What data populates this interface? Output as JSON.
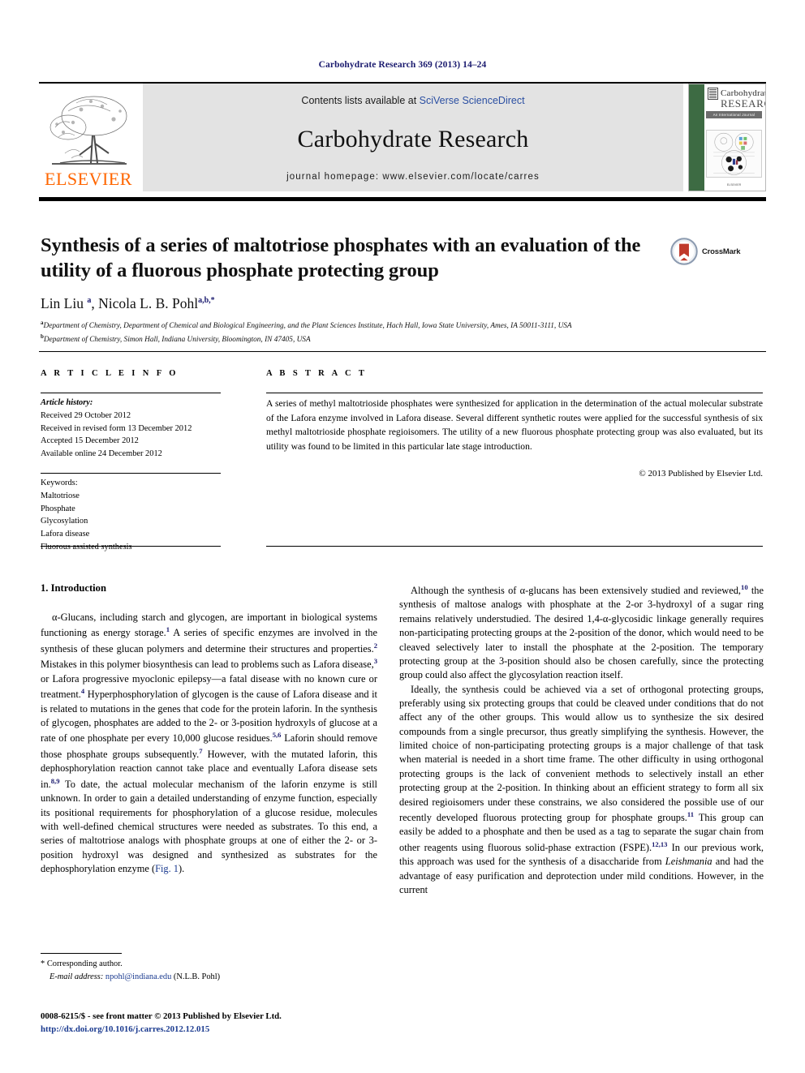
{
  "running_head": "Carbohydrate Research 369 (2013) 14–24",
  "masthead": {
    "publisher_logo_label": "ELSEVIER",
    "contents_prefix": "Contents lists available at ",
    "contents_link": "SciVerse ScienceDirect",
    "journal_title": "Carbohydrate Research",
    "homepage": "journal homepage: www.elsevier.com/locate/carres",
    "cover": {
      "line1": "Carbohydrate",
      "line2": "RESEARCH",
      "strap": "An International Journal",
      "footer": "ELSEVIER"
    }
  },
  "article": {
    "title": "Synthesis of a series of maltotriose phosphates with an evaluation of the utility of a fluorous phosphate protecting group",
    "crossmark_label": "CrossMark",
    "authors_html": "Lin Liu <sup>a</sup>, Nicola L. B. Pohl<sup>a,b,</sup><sup>*</sup>",
    "affiliations": [
      "Department of Chemistry, Department of Chemical and Biological Engineering, and the Plant Sciences Institute, Hach Hall, Iowa State University, Ames, IA 50011-3111, USA",
      "Department of Chemistry, Simon Hall, Indiana University, Bloomington, IN 47405, USA"
    ]
  },
  "article_info": {
    "heading": "A R T I C L E   I N F O",
    "history_label": "Article history:",
    "history": [
      "Received 29 October 2012",
      "Received in revised form 13 December 2012",
      "Accepted 15 December 2012",
      "Available online 24 December 2012"
    ],
    "keywords_label": "Keywords:",
    "keywords": [
      "Maltotriose",
      "Phosphate",
      "Glycosylation",
      "Lafora disease",
      "Fluorous assisted synthesis"
    ]
  },
  "abstract": {
    "heading": "A B S T R A C T",
    "text": "A series of methyl maltotrioside phosphates were synthesized for application in the determination of the actual molecular substrate of the Lafora enzyme involved in Lafora disease. Several different synthetic routes were applied for the successful synthesis of six methyl maltotrioside phosphate regioisomers. The utility of a new fluorous phosphate protecting group was also evaluated, but its utility was found to be limited in this particular late stage introduction.",
    "copyright": "© 2013 Published by Elsevier Ltd."
  },
  "body": {
    "section_heading": "1. Introduction",
    "left_column_html": "<p>&#945;-Glucans, including starch and glycogen, are important in biological systems functioning as energy storage.<sup>1</sup> A series of specific enzymes are involved in the synthesis of these glucan polymers and determine their structures and properties.<sup>2</sup> Mistakes in this polymer biosynthesis can lead to problems such as Lafora disease,<sup>3</sup> or Lafora progressive myoclonic epilepsy&#8212;a fatal disease with no known cure or treatment.<sup>4</sup> Hyperphosphorylation of glycogen is the cause of Lafora disease and it is related to mutations in the genes that code for the protein laforin. In the synthesis of glycogen, phosphates are added to the 2- or 3-position hydroxyls of glucose at a rate of one phosphate per every 10,000 glucose residues.<sup>5,6</sup> Laforin should remove those phosphate groups subsequently.<sup>7</sup> However, with the mutated laforin, this dephosphorylation reaction cannot take place and eventually Lafora disease sets in.<sup>8,9</sup> To date, the actual molecular mechanism of the laforin enzyme is still unknown. In order to gain a detailed understanding of enzyme function, especially its positional requirements for phosphorylation of a glucose residue, molecules with well-defined chemical structures were needed as substrates. To this end, a series of maltotriose analogs with phosphate groups at one of either the 2- or 3-position hydroxyl was designed and synthesized as substrates for the dephosphorylation enzyme (<span class=\"lnk\">Fig. 1</span>).</p>",
    "right_column_html": "<p>Although the synthesis of &#945;-glucans has been extensively studied and reviewed,<sup>10</sup> the synthesis of maltose analogs with phosphate at the 2-or 3-hydroxyl of a sugar ring remains relatively understudied. The desired 1,4-&#945;-glycosidic linkage generally requires non-participating protecting groups at the 2-position of the donor, which would need to be cleaved selectively later to install the phosphate at the 2-position. The temporary protecting group at the 3-position should also be chosen carefully, since the protecting group could also affect the glycosylation reaction itself.</p><p>Ideally, the synthesis could be achieved via a set of orthogonal protecting groups, preferably using six protecting groups that could be cleaved under conditions that do not affect any of the other groups. This would allow us to synthesize the six desired compounds from a single precursor, thus greatly simplifying the synthesis. However, the limited choice of non-participating protecting groups is a major challenge of that task when material is needed in a short time frame. The other difficulty in using orthogonal protecting groups is the lack of convenient methods to selectively install an ether protecting group at the 2-position. In thinking about an efficient strategy to form all six desired regioisomers under these constrains, we also considered the possible use of our recently developed fluorous protecting group for phosphate groups.<sup>11</sup> This group can easily be added to a phosphate and then be used as a tag to separate the sugar chain from other reagents using fluorous solid-phase extraction (FSPE).<sup>12,13</sup> In our previous work, this approach was used for the synthesis of a disaccharide from <span class=\"itx\">Leishmania</span> and had the advantage of easy purification and deprotection under mild conditions. However, in the current</p>"
  },
  "footnote": {
    "corresponding_marker": "*",
    "corresponding_label": "Corresponding author.",
    "email_label": "E-mail address:",
    "email": "npohl@indiana.edu",
    "email_owner": "(N.L.B. Pohl)"
  },
  "footer": {
    "issn_line": "0008-6215/$ - see front matter © 2013 Published by Elsevier Ltd.",
    "doi": "http://dx.doi.org/10.1016/j.carres.2012.12.015"
  },
  "colors": {
    "link_blue": "#2b4fa2",
    "ref_navy": "#1a1a6e",
    "elsevier_orange": "#ff6600",
    "banner_grey": "#e3e3e3",
    "cover_green": "#3d6b43",
    "crossmark_red": "#c0392b"
  }
}
